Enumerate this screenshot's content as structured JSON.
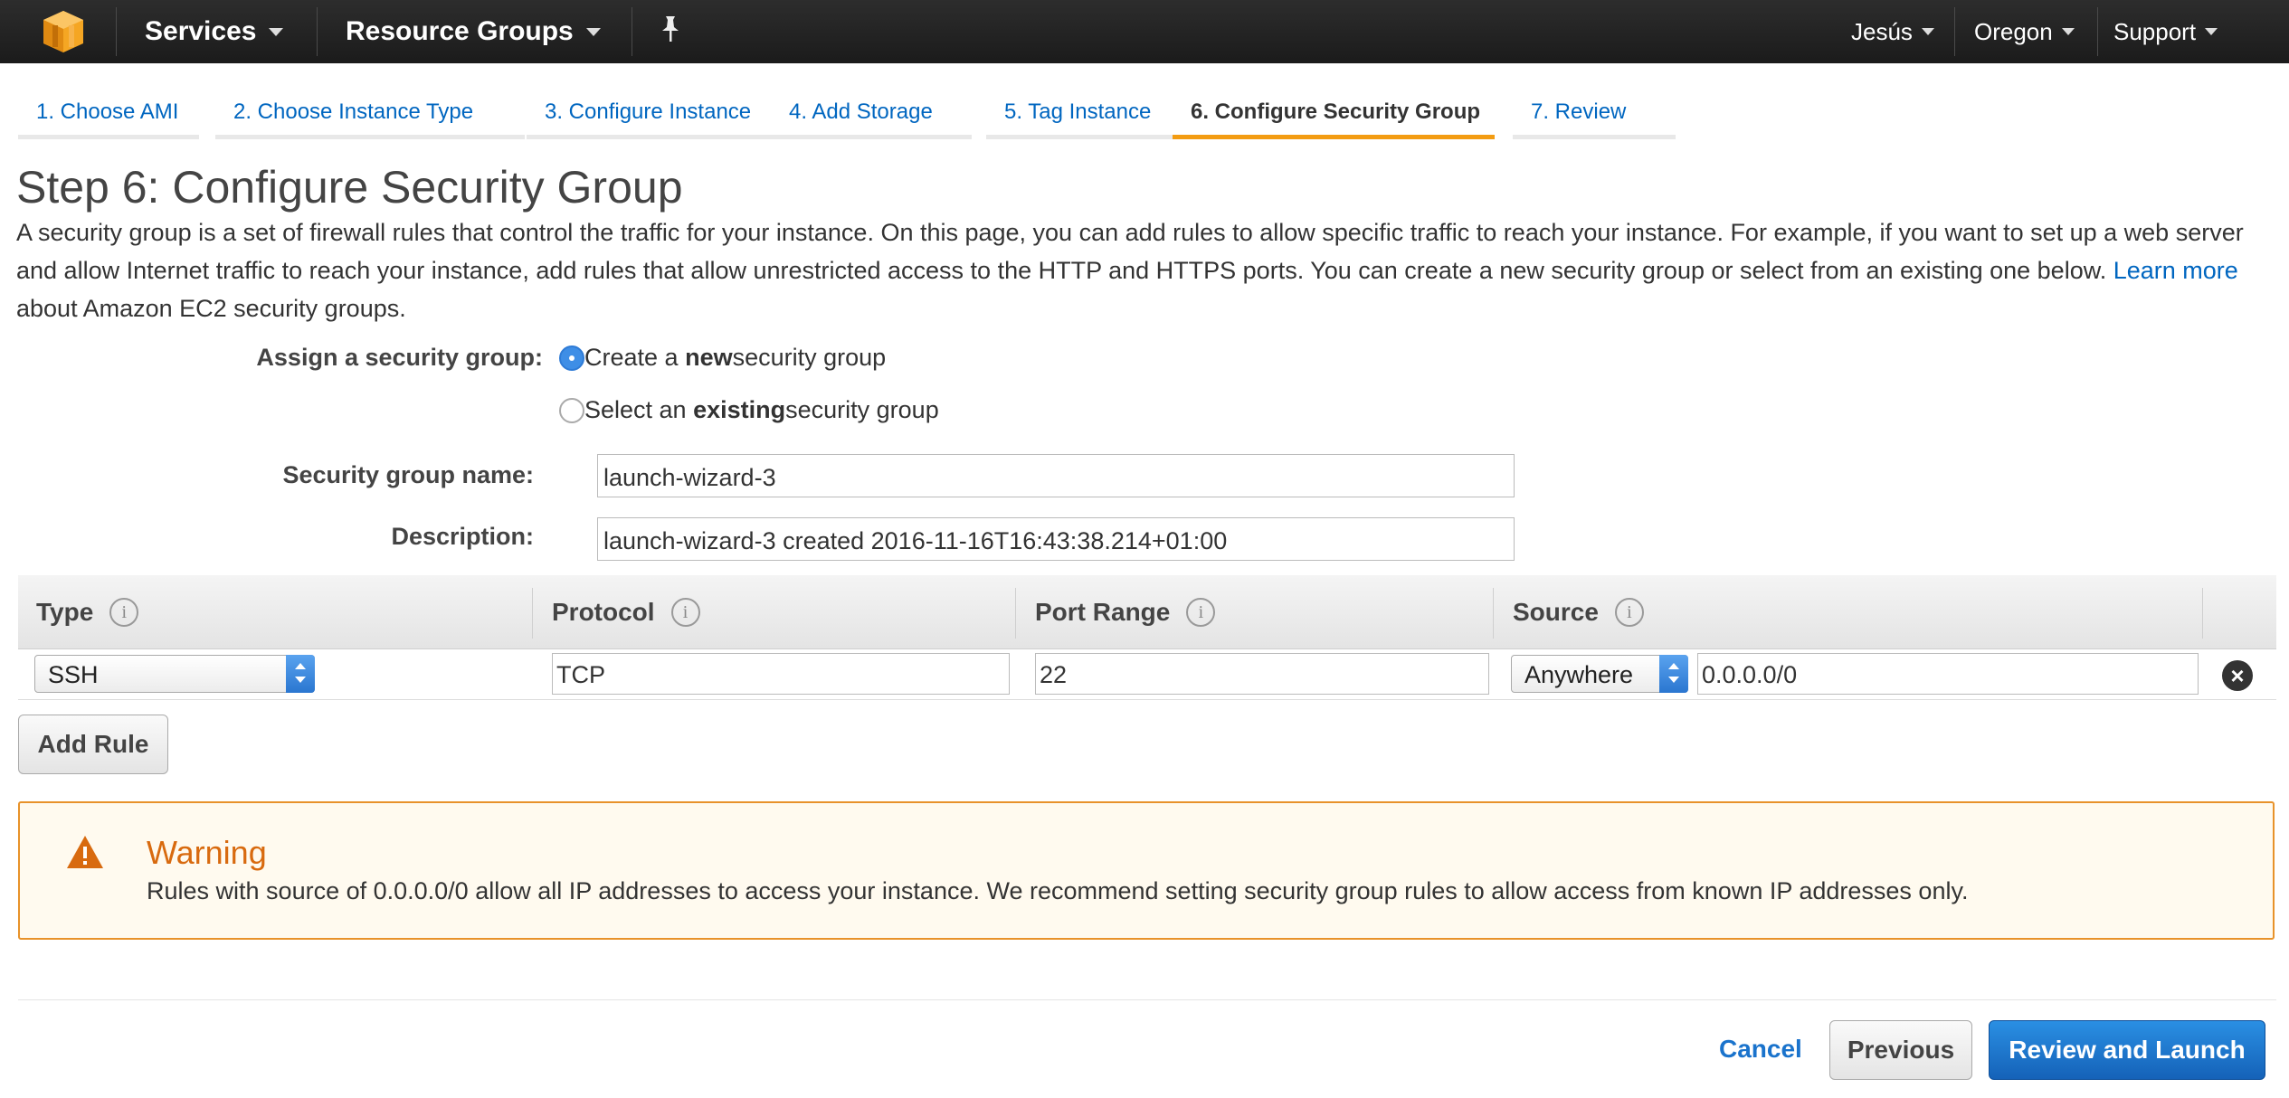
{
  "topnav": {
    "services": "Services",
    "resource_groups": "Resource Groups",
    "user": "Jesús",
    "region": "Oregon",
    "support": "Support",
    "logo_icon": "aws-cube-icon",
    "pin_icon": "pin-icon"
  },
  "tabs": [
    {
      "label": "1. Choose AMI"
    },
    {
      "label": "2. Choose Instance Type"
    },
    {
      "label": "3. Configure Instance"
    },
    {
      "label": "4. Add Storage"
    },
    {
      "label": "5. Tag Instance"
    },
    {
      "label": "6. Configure Security Group",
      "active": true
    },
    {
      "label": "7. Review"
    }
  ],
  "page": {
    "title": "Step 6: Configure Security Group",
    "intro_text": "A security group is a set of firewall rules that control the traffic for your instance. On this page, you can add rules to allow specific traffic to reach your instance. For example, if you want to set up a web server and allow Internet traffic to reach your instance, add rules that allow unrestricted access to the HTTP and HTTPS ports. You can create a new security group or select from an existing one below.",
    "learn_more": "Learn more",
    "intro_tail": "about Amazon EC2 security groups."
  },
  "form": {
    "assign_label": "Assign a security group:",
    "option_new_pre": "Create a ",
    "option_new_bold": "new",
    "option_new_post": " security group",
    "option_existing_pre": "Select an ",
    "option_existing_bold": "existing",
    "option_existing_post": " security group",
    "selected_option": "new",
    "name_label": "Security group name:",
    "name_value": "launch-wizard-3",
    "description_label": "Description:",
    "description_value": "launch-wizard-3 created 2016-11-16T16:43:38.214+01:00"
  },
  "rules_table": {
    "headers": [
      "Type",
      "Protocol",
      "Port Range",
      "Source"
    ],
    "info_glyph": "i",
    "rows": [
      {
        "type": "SSH",
        "protocol": "TCP",
        "port_range": "22",
        "source_select": "Anywhere",
        "source_cidr": "0.0.0.0/0"
      }
    ],
    "add_rule": "Add Rule"
  },
  "warning": {
    "title": "Warning",
    "text": "Rules with source of 0.0.0.0/0 allow all IP addresses to access your instance. We recommend setting security group rules to allow access from known IP addresses only.",
    "color": "#e8922a"
  },
  "footer": {
    "cancel": "Cancel",
    "previous": "Previous",
    "review_launch": "Review and Launch"
  }
}
